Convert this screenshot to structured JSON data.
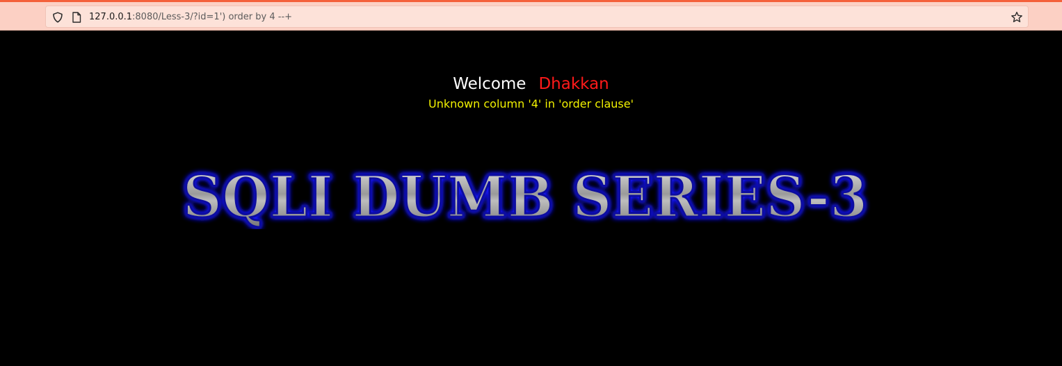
{
  "browser": {
    "url_host": "127.0.0.1",
    "url_rest": ":8080/Less-3/?id=1') order by 4 --+",
    "icons": [
      "shield-icon",
      "page-icon",
      "star-icon"
    ],
    "accent_color": "#f4603a"
  },
  "page": {
    "welcome_label": "Welcome",
    "welcome_name": "Dhakkan",
    "error_message": "Unknown column '4' in 'order clause'",
    "title_banner": "SQLI DUMB SERIES-3",
    "colors": {
      "background": "#000000",
      "welcome": "#ffffff",
      "name": "#ff1a1a",
      "error": "#f2f200",
      "title_glow": "#1a1aff",
      "title_fill": "#a8a8a8"
    }
  }
}
